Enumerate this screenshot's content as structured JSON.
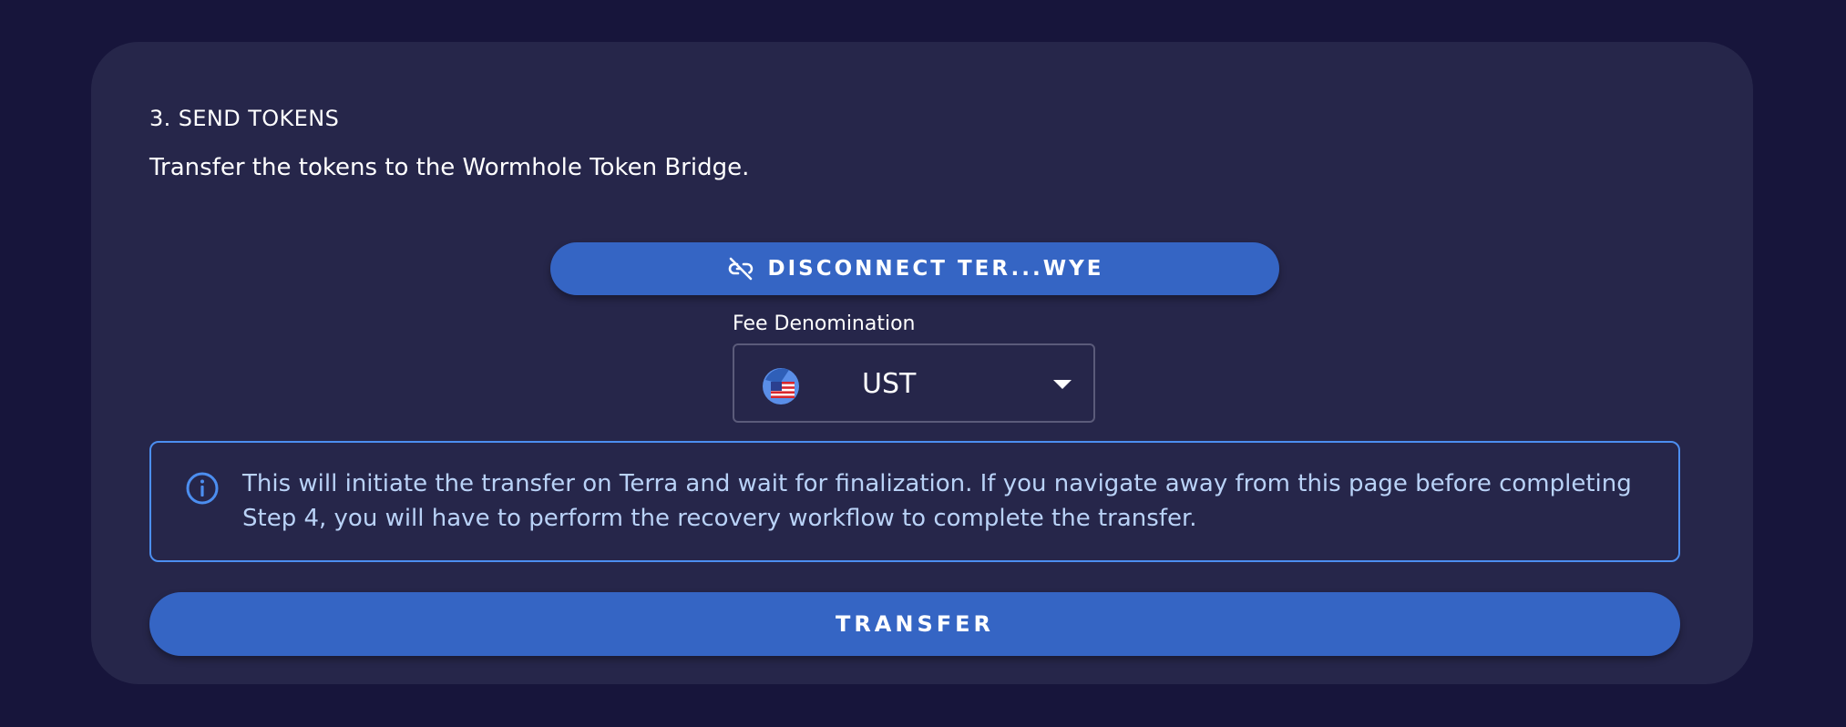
{
  "step": {
    "title": "3. SEND TOKENS",
    "description": "Transfer the tokens to the Wormhole Token Bridge."
  },
  "wallet": {
    "disconnect_label": "DISCONNECT TER...WYE",
    "icon": "link-off-icon"
  },
  "fee": {
    "label": "Fee Denomination",
    "selected": "UST",
    "icon": "ust-token-icon"
  },
  "alert": {
    "icon": "info-icon",
    "text": "This will initiate the transfer on Terra and wait for finalization. If you navigate away from this page before completing Step 4, you will have to perform the recovery workflow to complete the transfer."
  },
  "actions": {
    "transfer_label": "TRANSFER"
  },
  "colors": {
    "background": "#17153b",
    "card": "#26264a",
    "primary": "#3565c4",
    "info_border": "#4c8ef0",
    "info_text": "#b9d2f7"
  }
}
